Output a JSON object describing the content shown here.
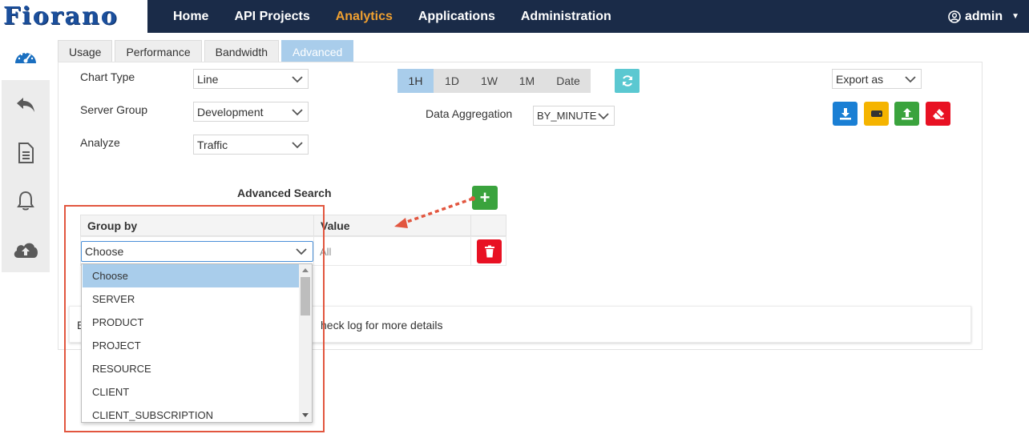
{
  "brand": {
    "logo": "Fiorano"
  },
  "topnav": {
    "items": [
      "Home",
      "API Projects",
      "Analytics",
      "Applications",
      "Administration"
    ],
    "active": "Analytics",
    "user": "admin",
    "user_icon": "user-circle-icon",
    "accent_color": "#f0a030",
    "bar_color": "#1a2b48"
  },
  "sidebar": {
    "top_icon": "speedometer-icon",
    "items": [
      "back-arrow-icon",
      "document-icon",
      "bell-icon",
      "cloud-upload-icon"
    ]
  },
  "tabs": [
    "Usage",
    "Performance",
    "Bandwidth",
    "Advanced"
  ],
  "active_tab": "Advanced",
  "filters": {
    "chart_type_label": "Chart Type",
    "chart_type_value": "Line",
    "server_group_label": "Server Group",
    "server_group_value": "Development",
    "analyze_label": "Analyze",
    "analyze_value": "Traffic"
  },
  "time_range": {
    "options": [
      "1H",
      "1D",
      "1W",
      "1M",
      "Date"
    ],
    "selected": "1H"
  },
  "aggregation": {
    "label": "Data Aggregation",
    "value": "BY_MINUTE"
  },
  "export": {
    "label": "Export as",
    "buttons": [
      {
        "icon": "download-icon",
        "color": "#1a7fd4"
      },
      {
        "icon": "hard-drive-icon",
        "color": "#f5b400"
      },
      {
        "icon": "upload-icon",
        "color": "#3aa33d"
      },
      {
        "icon": "eraser-icon",
        "color": "#e81123"
      }
    ]
  },
  "advanced_search": {
    "title": "Advanced Search",
    "columns": [
      "Group by",
      "Value"
    ],
    "group_by_value": "Choose",
    "value_text": "All"
  },
  "message": {
    "prefix": "E",
    "text": "heck log for more details"
  },
  "dropdown": {
    "options": [
      "Choose",
      "SERVER",
      "PRODUCT",
      "PROJECT",
      "RESOURCE",
      "CLIENT",
      "CLIENT_SUBSCRIPTION"
    ],
    "selected": "Choose"
  }
}
